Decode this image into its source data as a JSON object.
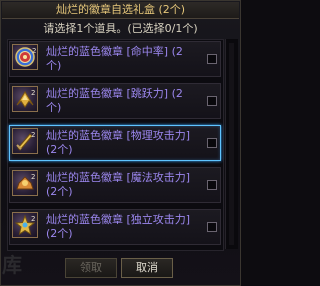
{
  "dialog": {
    "title": "灿烂的徽章自选礼盒 (2个)",
    "subtitle": "请选择1个道具。(已选择0/1个)",
    "watermark": "库"
  },
  "items": [
    {
      "name": "灿烂的蓝色徽章 [命中率] (2个)",
      "icon": "target-badge-icon",
      "selected": false
    },
    {
      "name": "灿烂的蓝色徽章 [跳跃力] (2个)",
      "icon": "wing-badge-icon",
      "selected": false
    },
    {
      "name": "灿烂的蓝色徽章 [物理攻击力] (2个)",
      "icon": "sword-badge-icon",
      "selected": true
    },
    {
      "name": "灿烂的蓝色徽章 [魔法攻击力] (2个)",
      "icon": "magic-badge-icon",
      "selected": false
    },
    {
      "name": "灿烂的蓝色徽章 [独立攻击力] (2个)",
      "icon": "star-badge-icon",
      "selected": false
    }
  ],
  "buttons": {
    "confirm_label": "领取",
    "cancel_label": "取消"
  },
  "colors": {
    "title": "#e6c77a",
    "item_name": "#9c87ef",
    "selected_border": "#5fc4ff"
  }
}
